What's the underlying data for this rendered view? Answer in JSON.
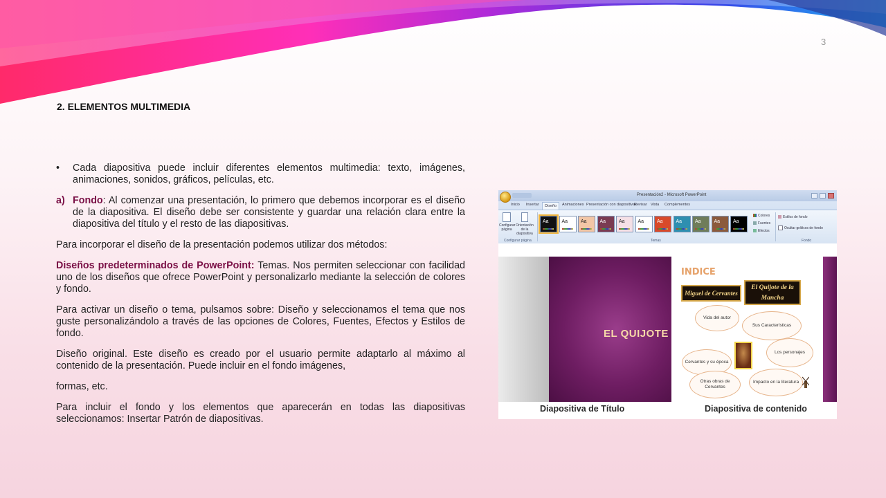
{
  "slide": {
    "number": "3",
    "title": "2. ELEMENTOS MULTIMEDIA"
  },
  "content": {
    "bullet_marker": "•",
    "bullet_text": "Cada diapositiva puede incluir diferentes elementos multimedia: texto, imágenes, animaciones, sonidos, gráficos, películas, etc.",
    "item_a_marker": "a)",
    "item_a_term": "Fondo",
    "item_a_text": ": Al comenzar una presentación, lo primero que debemos incorporar es el diseño de la diapositiva. El diseño debe ser consistente y guardar una relación clara entre la diapositiva del título y el resto de las diapositivas.",
    "para_methods": "Para incorporar el diseño de la presentación podemos utilizar dos métodos:",
    "predef_term": "Diseños predeterminados de PowerPoint:",
    "predef_text": " Temas. Nos permiten seleccionar con facilidad uno de los diseños que ofrece PowerPoint y personalizarlo mediante la selección de colores y fondo.",
    "para_activate": "Para activar un diseño o tema, pulsamos sobre: Diseño y seleccionamos el tema que nos guste personalizándolo a través de las opciones de Colores, Fuentes, Efectos y Estilos de fondo.",
    "para_original": "Diseño original. Este diseño es creado por el usuario permite adaptarlo al máximo al contenido de la presentación. Puede incluir en el fondo imágenes,",
    "para_formas": "formas, etc.",
    "para_include": "Para incluir el fondo y los elementos que aparecerán en todas las diapositivas seleccionamos: Insertar Patrón de diapositivas."
  },
  "screenshot": {
    "window_title": "Presentación2 - Microsoft PowerPoint",
    "tabs": [
      "Inicio",
      "Insertar",
      "Diseño",
      "Animaciones",
      "Presentación con diapositivas",
      "Revisar",
      "Vista",
      "Complementos"
    ],
    "active_tab": "Diseño",
    "config_buttons": [
      "Configurar página",
      "Orientación de la diapositiva"
    ],
    "group_labels": [
      "Configurar página",
      "Temas",
      "Fondo"
    ],
    "theme_label": "Aa",
    "theme_colors": [
      "#111111",
      "#ffffff",
      "#f2c6a6",
      "#7a3b52",
      "#f5e0e6",
      "#ffffff",
      "#d84a2a",
      "#2e8fb0",
      "#6f7c5a",
      "#8b5a3c",
      "#000000"
    ],
    "theme_options": [
      "Colores",
      "Fuentes",
      "Efectos"
    ],
    "background_options": [
      "Estilos de fondo",
      "Ocultar gráficos de fondo"
    ],
    "title_slide_text": "EL QUIJOTE",
    "indice_text": "INDICE",
    "label_author": "Miguel de Cervantes",
    "label_book": "El Quijote de la Mancha",
    "bubbles": [
      "Vida del autor",
      "Sus Características",
      "Los personajes",
      "Cervantes y su época",
      "Otras obras de Cervantes",
      "Impacto en la literatura"
    ],
    "caption_title": "Diapositiva de Título",
    "caption_content": "Diapositiva de contenido"
  },
  "colors": {
    "accent": "#7a1046",
    "title_slide_bg": "#6e1d62"
  }
}
